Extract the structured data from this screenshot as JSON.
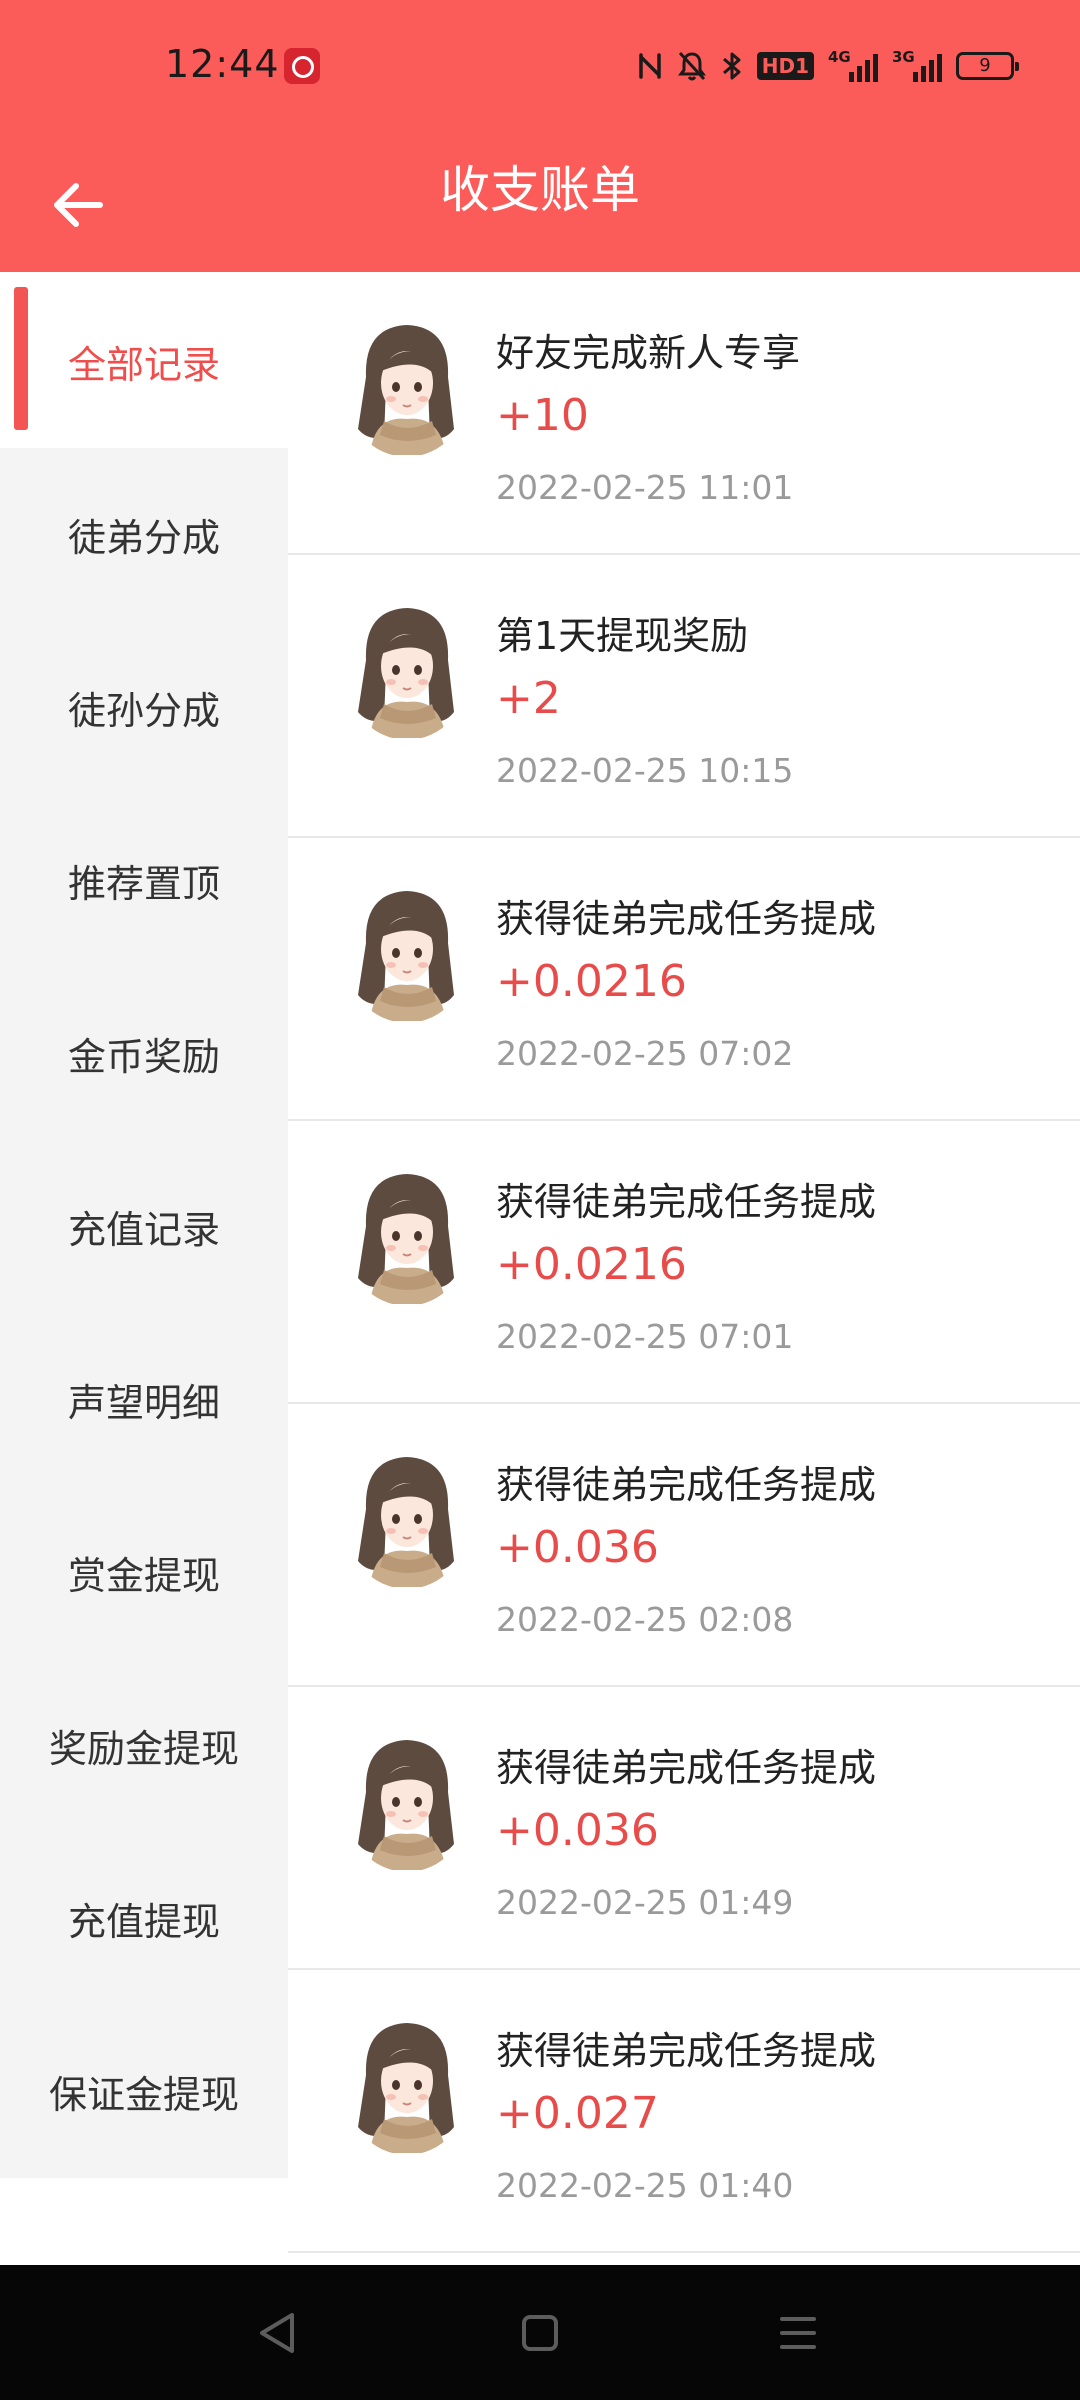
{
  "status_bar": {
    "time": "12:44",
    "app_icon": "bank-icon",
    "icons": [
      "nfc-icon",
      "mute-icon",
      "bluetooth-icon",
      "hd-icon",
      "signal-4g-icon",
      "signal-3g-icon",
      "battery-icon"
    ],
    "hd": "HD1",
    "net1": "4G",
    "net2": "3G",
    "battery": "9"
  },
  "header": {
    "title": "收支账单",
    "back_icon": "arrow-left-icon",
    "background": "#fb5c5a"
  },
  "sidebar": {
    "active_color": "#ee4e4c",
    "items": [
      {
        "label": "全部记录",
        "active": true
      },
      {
        "label": "徒弟分成",
        "active": false
      },
      {
        "label": "徒孙分成",
        "active": false
      },
      {
        "label": "推荐置顶",
        "active": false
      },
      {
        "label": "金币奖励",
        "active": false
      },
      {
        "label": "充值记录",
        "active": false
      },
      {
        "label": "声望明细",
        "active": false
      },
      {
        "label": "赏金提现",
        "active": false
      },
      {
        "label": "奖励金提现",
        "active": false
      },
      {
        "label": "充值提现",
        "active": false
      },
      {
        "label": "保证金提现",
        "active": false
      }
    ]
  },
  "records": [
    {
      "title": "好友完成新人专享",
      "amount": "+10",
      "time": "2022-02-25 11:01"
    },
    {
      "title": "第1天提现奖励",
      "amount": "+2",
      "time": "2022-02-25 10:15"
    },
    {
      "title": "获得徒弟完成任务提成",
      "amount": "+0.0216",
      "time": "2022-02-25 07:02"
    },
    {
      "title": "获得徒弟完成任务提成",
      "amount": "+0.0216",
      "time": "2022-02-25 07:01"
    },
    {
      "title": "获得徒弟完成任务提成",
      "amount": "+0.036",
      "time": "2022-02-25 02:08"
    },
    {
      "title": "获得徒弟完成任务提成",
      "amount": "+0.036",
      "time": "2022-02-25 01:49"
    },
    {
      "title": "获得徒弟完成任务提成",
      "amount": "+0.027",
      "time": "2022-02-25 01:40"
    }
  ],
  "nav_bar": {
    "buttons": [
      "back-triangle-icon",
      "home-square-icon",
      "menu-lines-icon"
    ]
  }
}
